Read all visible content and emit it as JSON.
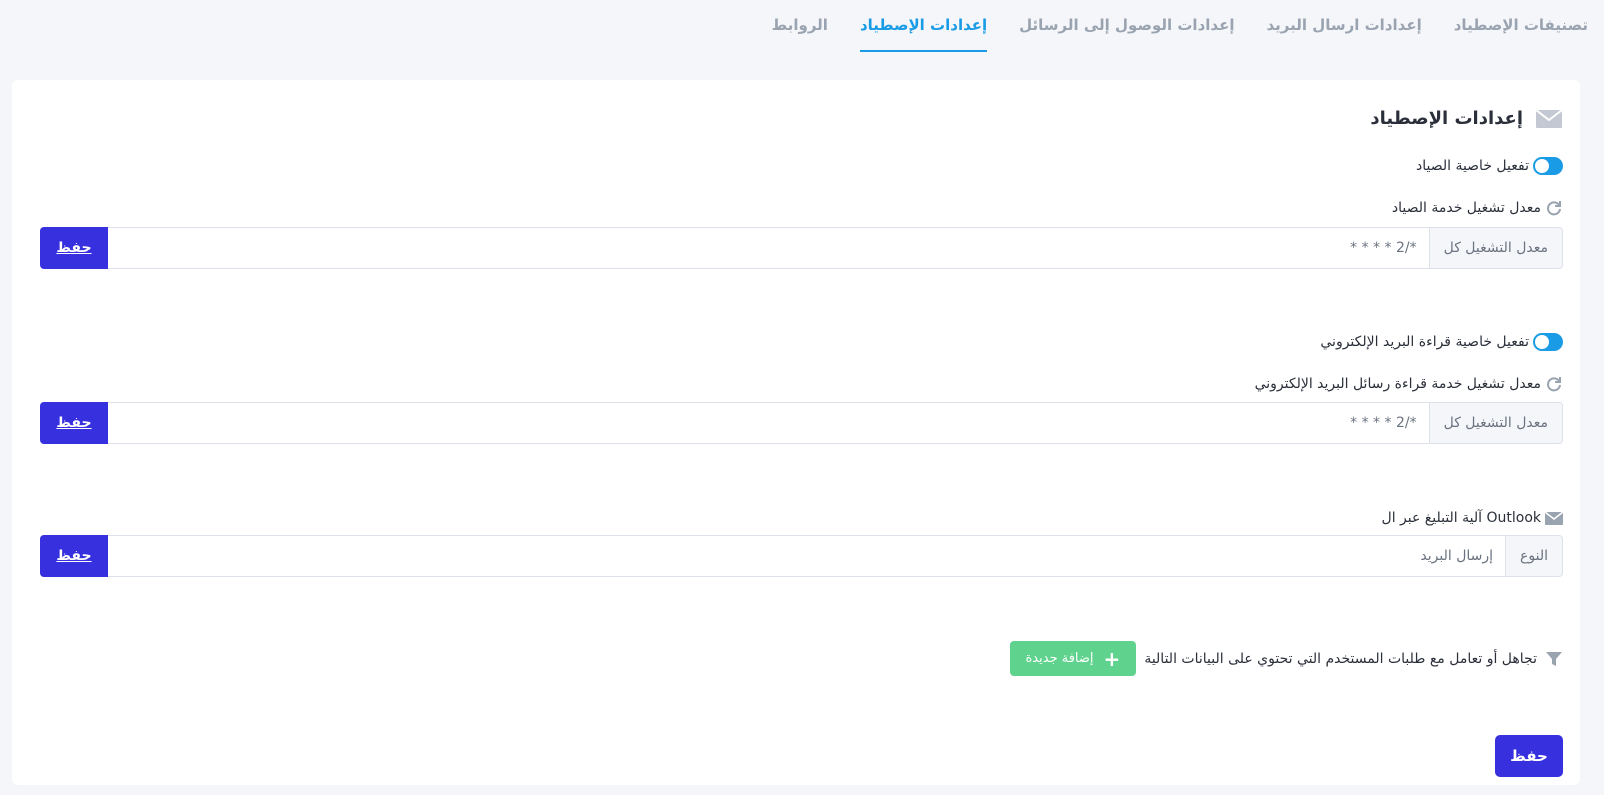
{
  "tabs": [
    {
      "label": "تصنيفات الإصطياد",
      "active": false
    },
    {
      "label": "إعدادات ارسال البريد",
      "active": false
    },
    {
      "label": "إعدادات الوصول إلى الرسائل",
      "active": false
    },
    {
      "label": "إعدادات الإصطياد",
      "active": true
    },
    {
      "label": "الروابط",
      "active": false
    }
  ],
  "section": {
    "title": "إعدادات الإصطياد",
    "icon": "envelope-icon"
  },
  "hunting": {
    "toggle_label": "تفعيل خاصية الصياد",
    "toggle_on": true,
    "rate_label": "معدل تشغيل خدمة الصياد",
    "addon": "معدل التشغيل كل",
    "value": "*/2 * * * *",
    "save": "حفظ"
  },
  "email_reading": {
    "toggle_label": "تفعيل خاصية قراءة البريد الإلكتروني",
    "toggle_on": true,
    "rate_label": "معدل تشغيل خدمة قراءة رسائل البريد الإلكتروني",
    "addon": "معدل التشغيل كل",
    "value": "*/2 * * * *",
    "save": "حفظ"
  },
  "outlook": {
    "label": "آلية التبليغ عبر ال Outlook",
    "addon": "النوع",
    "value": "إرسال البريد",
    "save": "حفظ"
  },
  "filter": {
    "label": "تجاهل أو تعامل مع طلبات المستخدم التي تحتوي على البيانات التالية",
    "add_button": "إضافة جديدة"
  },
  "main_save": "حفظ",
  "colors": {
    "accent": "#1a9be6",
    "primary_button": "#3730df",
    "add_button": "#5fd38d"
  }
}
